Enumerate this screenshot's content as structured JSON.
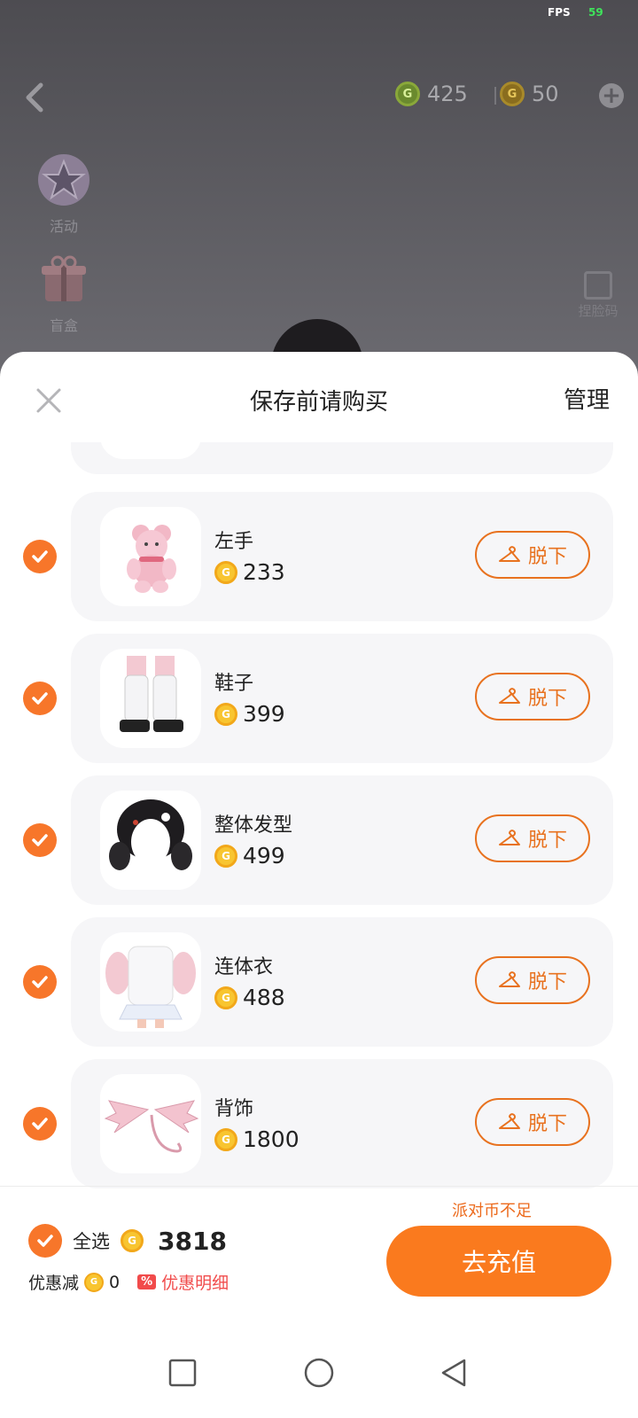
{
  "status": {
    "fps_label": "FPS",
    "fps_value": "59"
  },
  "topbar": {
    "coin_green": "425",
    "coin_gold": "50",
    "coin_symbol": "G"
  },
  "side_menu": [
    {
      "label": "活动"
    },
    {
      "label": "盲盒"
    }
  ],
  "face_button": {
    "label": "捏脸码"
  },
  "sheet": {
    "title": "保存前请购买",
    "manage": "管理"
  },
  "items": [
    {
      "name": "左手",
      "price": "233",
      "button": "脱下",
      "checked": true
    },
    {
      "name": "鞋子",
      "price": "399",
      "button": "脱下",
      "checked": true
    },
    {
      "name": "整体发型",
      "price": "499",
      "button": "脱下",
      "checked": true
    },
    {
      "name": "连体衣",
      "price": "488",
      "button": "脱下",
      "checked": true
    },
    {
      "name": "背饰",
      "price": "1800",
      "button": "脱下",
      "checked": true
    }
  ],
  "footer": {
    "shortage_notice": "派对币不足",
    "select_all": "全选",
    "total": "3818",
    "discount_label": "优惠减",
    "discount_value": "0",
    "discount_badge": "%",
    "discount_detail": "优惠明细",
    "recharge": "去充值"
  },
  "colors": {
    "accent": "#FA7A1E",
    "sale_red": "#F14B4B",
    "coin_gold": "#F8C530"
  }
}
